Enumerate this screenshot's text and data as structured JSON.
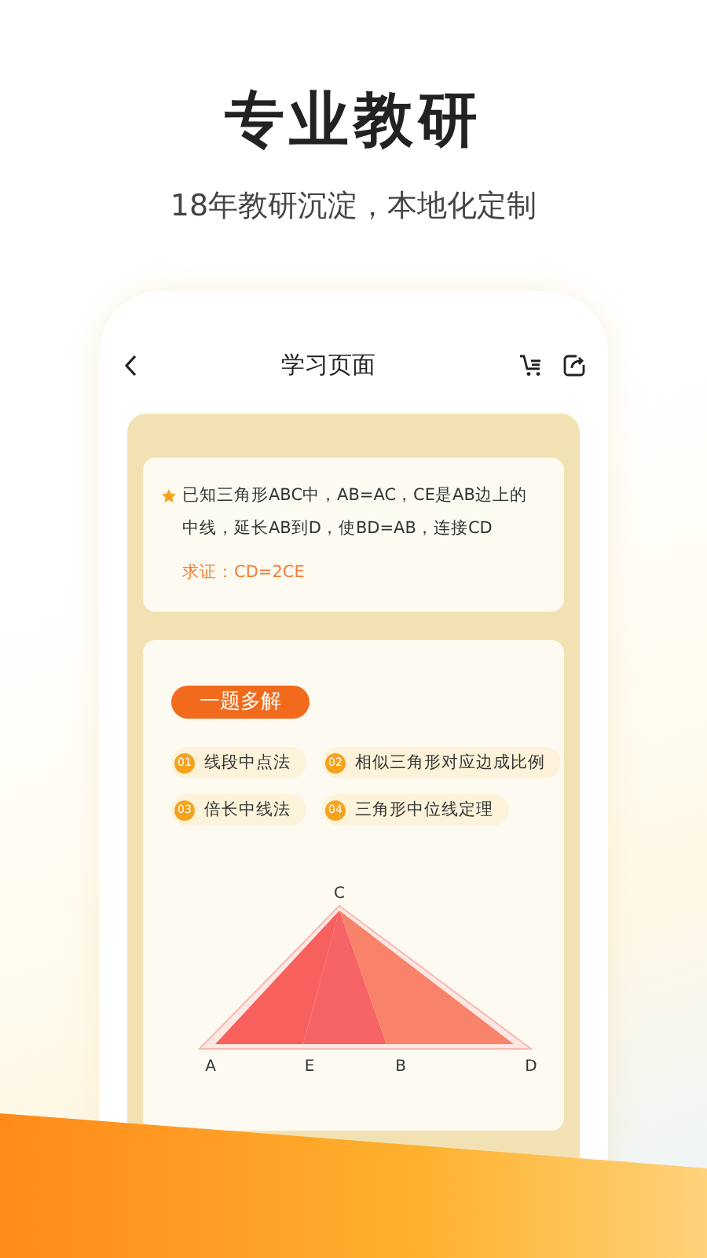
{
  "headline": "专业教研",
  "subtitle": "18年教研沉淀，本地化定制",
  "screen": {
    "title": "学习页面",
    "problem": {
      "text": "已知三角形ABC中，AB=AC，CE是AB边上的中线，延长AB到D，使BD=AB，连接CD",
      "proof": "求证：CD=2CE"
    },
    "solutions": {
      "badge": "一题多解",
      "methods": [
        {
          "number": "01",
          "label": "线段中点法"
        },
        {
          "number": "02",
          "label": "相似三角形对应边成比例"
        },
        {
          "number": "03",
          "label": "倍长中线法"
        },
        {
          "number": "04",
          "label": "三角形中位线定理"
        }
      ],
      "diagram_labels": [
        "C",
        "A",
        "E",
        "B",
        "D"
      ]
    }
  }
}
